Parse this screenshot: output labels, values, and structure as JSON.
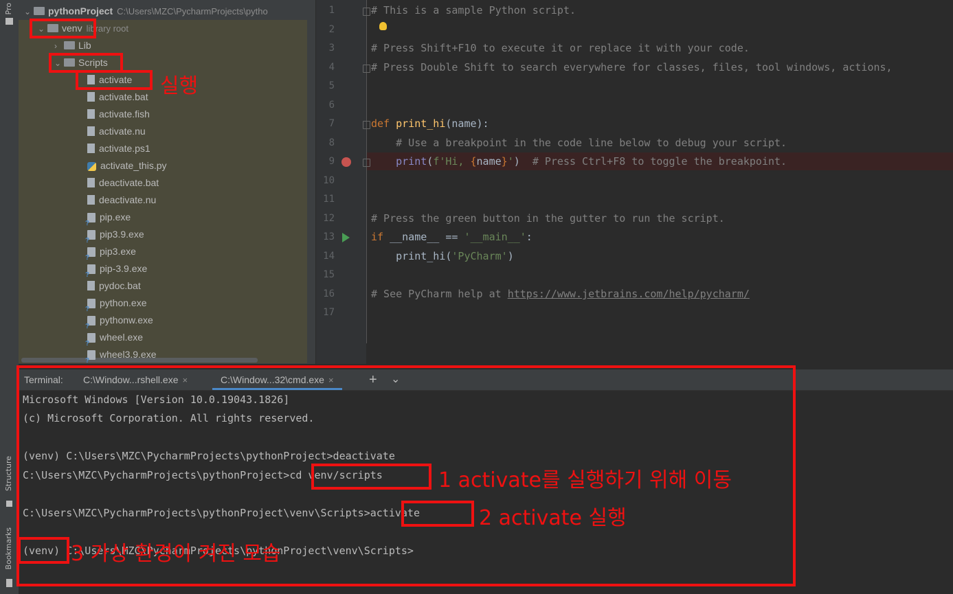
{
  "sidebar": {
    "project_tab": "Pro",
    "structure_tab": "Structure",
    "bookmarks_tab": "Bookmarks"
  },
  "project_tree": {
    "root_name": "pythonProject",
    "root_path": "C:\\Users\\MZC\\PycharmProjects\\pytho",
    "venv_name": "venv",
    "venv_hint": "library root",
    "lib_name": "Lib",
    "scripts_name": "Scripts",
    "files": [
      "activate",
      "activate.bat",
      "activate.fish",
      "activate.nu",
      "activate.ps1",
      "activate_this.py",
      "deactivate.bat",
      "deactivate.nu",
      "pip.exe",
      "pip3.9.exe",
      "pip3.exe",
      "pip-3.9.exe",
      "pydoc.bat",
      "python.exe",
      "pythonw.exe",
      "wheel.exe",
      "wheel3.9.exe"
    ]
  },
  "editor": {
    "line_numbers": [
      "1",
      "2",
      "3",
      "4",
      "5",
      "6",
      "7",
      "8",
      "9",
      "10",
      "11",
      "12",
      "13",
      "14",
      "15",
      "16",
      "17"
    ],
    "lines": {
      "l1": "# This is a sample Python script.",
      "l3": "# Press Shift+F10 to execute it or replace it with your code.",
      "l4": "# Press Double Shift to search everywhere for classes, files, tool windows, actions,",
      "l7_kw": "def",
      "l7_fn": "print_hi",
      "l7_rest": "(name):",
      "l8": "    # Use a breakpoint in the code line below to debug your script.",
      "l9_indent": "    ",
      "l9_bi": "print",
      "l9_p1": "(",
      "l9_str1": "f'Hi, ",
      "l9_brace1": "{",
      "l9_var": "name",
      "l9_brace2": "}",
      "l9_str2": "'",
      "l9_p2": ")  ",
      "l9_cm": "# Press Ctrl+F8 to toggle the breakpoint.",
      "l12": "# Press the green button in the gutter to run the script.",
      "l13_kw": "if",
      "l13_mid": " __name__ == ",
      "l13_str": "'__main__'",
      "l13_end": ":",
      "l14_a": "    print_hi(",
      "l14_str": "'PyCharm'",
      "l14_b": ")",
      "l16_a": "# See PyCharm help at ",
      "l16_link": "https://www.jetbrains.com/help/pycharm/"
    }
  },
  "terminal": {
    "label": "Terminal:",
    "tabs": [
      {
        "label": "C:\\Window...rshell.exe"
      },
      {
        "label": "C:\\Window...32\\cmd.exe"
      }
    ],
    "add": "+",
    "menu": "⌄",
    "close": "×",
    "lines": [
      "Microsoft Windows [Version 10.0.19043.1826]",
      "(c) Microsoft Corporation. All rights reserved.",
      "(venv) C:\\Users\\MZC\\PycharmProjects\\pythonProject>deactivate",
      "C:\\Users\\MZC\\PycharmProjects\\pythonProject>cd venv/scripts",
      "C:\\Users\\MZC\\PycharmProjects\\pythonProject\\venv\\Scripts>activate",
      "(venv) C:\\Users\\MZC\\PycharmProjects\\pythonProject\\venv\\Scripts>"
    ]
  },
  "annotations": {
    "run": "실행",
    "step1": "1 activate를 실행하기 위해 이동",
    "step2": "2 activate 실행",
    "step3": "3 가상 환경이 켜진 모습"
  },
  "colors": {
    "annotation_red": "#ee1111",
    "tab_accent": "#4a88c7",
    "breakpoint": "#c75450",
    "run_green": "#499c54"
  }
}
